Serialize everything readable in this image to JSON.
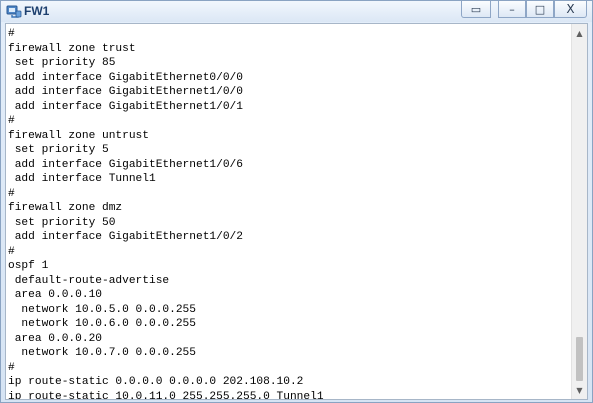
{
  "window": {
    "title": "FW1",
    "controls": {
      "extra": "▭",
      "minimize": "–",
      "maximize": "□",
      "close": "X"
    },
    "accent": "#1d3f6e"
  },
  "console": {
    "lines": [
      "#",
      "firewall zone trust",
      " set priority 85",
      " add interface GigabitEthernet0/0/0",
      " add interface GigabitEthernet1/0/0",
      " add interface GigabitEthernet1/0/1",
      "#",
      "firewall zone untrust",
      " set priority 5",
      " add interface GigabitEthernet1/0/6",
      " add interface Tunnel1",
      "#",
      "firewall zone dmz",
      " set priority 50",
      " add interface GigabitEthernet1/0/2",
      "#",
      "ospf 1",
      " default-route-advertise",
      " area 0.0.0.10",
      "  network 10.0.5.0 0.0.0.255",
      "  network 10.0.6.0 0.0.0.255",
      " area 0.0.0.20",
      "  network 10.0.7.0 0.0.0.255",
      "#",
      "ip route-static 0.0.0.0 0.0.0.0 202.108.10.2",
      "ip route-static 10.0.11.0 255.255.255.0 Tunnel1"
    ]
  },
  "scrollbar": {
    "up_icon": "arrow-up",
    "down_icon": "arrow-down",
    "up_glyph": "▲",
    "down_glyph": "▼",
    "position_fraction": 0.93
  }
}
